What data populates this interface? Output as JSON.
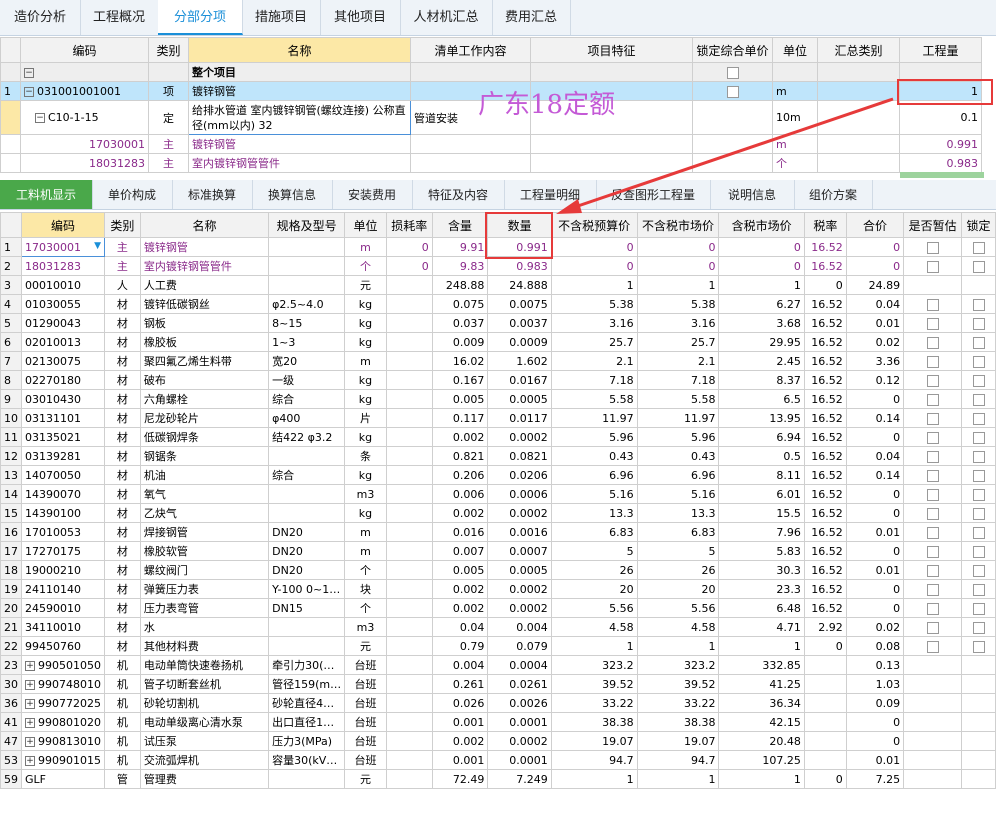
{
  "top_tabs": [
    "造价分析",
    "工程概况",
    "分部分项",
    "措施项目",
    "其他项目",
    "人材机汇总",
    "费用汇总"
  ],
  "upper_table": {
    "headers": [
      "编码",
      "类别",
      "名称",
      "清单工作内容",
      "项目特征",
      "锁定综合单价",
      "单位",
      "汇总类别",
      "工程量"
    ],
    "rows": [
      {
        "no": "",
        "code": "",
        "type": "",
        "name": "整个项目",
        "content": "",
        "feature": "",
        "unit": "",
        "sum": "",
        "qty": ""
      },
      {
        "no": "1",
        "code": "031001001001",
        "type": "项",
        "name": "镀锌钢管",
        "content": "",
        "feature": "",
        "unit": "m",
        "sum": "",
        "qty": "1"
      },
      {
        "no": "",
        "code": "C10-1-15",
        "type": "定",
        "name": "给排水管道 室内镀锌钢管(螺纹连接) 公称直径(mm以内) 32",
        "content": "管道安装",
        "feature": "",
        "unit": "10m",
        "sum": "",
        "qty": "0.1"
      },
      {
        "no": "",
        "code": "17030001",
        "type": "主",
        "name": "镀锌钢管",
        "content": "",
        "feature": "",
        "unit": "m",
        "sum": "",
        "qty": "0.991"
      },
      {
        "no": "",
        "code": "18031283",
        "type": "主",
        "name": "室内镀锌钢管管件",
        "content": "",
        "feature": "",
        "unit": "个",
        "sum": "",
        "qty": "0.983"
      }
    ]
  },
  "watermark": "广东18定额",
  "lower_tabs": [
    "工料机显示",
    "单价构成",
    "标准换算",
    "换算信息",
    "安装费用",
    "特征及内容",
    "工程量明细",
    "反查图形工程量",
    "说明信息",
    "组价方案"
  ],
  "lower_table": {
    "headers": [
      "编码",
      "类别",
      "名称",
      "规格及型号",
      "单位",
      "损耗率",
      "含量",
      "数量",
      "不含税预算价",
      "不含税市场价",
      "含税市场价",
      "税率",
      "合价",
      "是否暂估",
      "锁定"
    ],
    "rows": [
      {
        "no": "1",
        "exp": false,
        "code": "17030001",
        "type": "主",
        "name": "镀锌钢管",
        "spec": "",
        "unit": "m",
        "loss": "0",
        "content": "9.91",
        "qty": "0.991",
        "p1": "0",
        "p2": "0",
        "p3": "0",
        "tax": "16.52",
        "total": "0",
        "chk": true,
        "purple": true
      },
      {
        "no": "2",
        "exp": false,
        "code": "18031283",
        "type": "主",
        "name": "室内镀锌钢管管件",
        "spec": "",
        "unit": "个",
        "loss": "0",
        "content": "9.83",
        "qty": "0.983",
        "p1": "0",
        "p2": "0",
        "p3": "0",
        "tax": "16.52",
        "total": "0",
        "chk": true,
        "purple": true
      },
      {
        "no": "3",
        "exp": false,
        "code": "00010010",
        "type": "人",
        "name": "人工费",
        "spec": "",
        "unit": "元",
        "loss": "",
        "content": "248.88",
        "qty": "24.888",
        "p1": "1",
        "p2": "1",
        "p3": "1",
        "tax": "0",
        "total": "24.89",
        "chk": false
      },
      {
        "no": "4",
        "exp": false,
        "code": "01030055",
        "type": "材",
        "name": "镀锌低碳钢丝",
        "spec": "φ2.5~4.0",
        "unit": "kg",
        "loss": "",
        "content": "0.075",
        "qty": "0.0075",
        "p1": "5.38",
        "p2": "5.38",
        "p3": "6.27",
        "tax": "16.52",
        "total": "0.04",
        "chk": true
      },
      {
        "no": "5",
        "exp": false,
        "code": "01290043",
        "type": "材",
        "name": "钢板",
        "spec": "8~15",
        "unit": "kg",
        "loss": "",
        "content": "0.037",
        "qty": "0.0037",
        "p1": "3.16",
        "p2": "3.16",
        "p3": "3.68",
        "tax": "16.52",
        "total": "0.01",
        "chk": true
      },
      {
        "no": "6",
        "exp": false,
        "code": "02010013",
        "type": "材",
        "name": "橡胶板",
        "spec": "1~3",
        "unit": "kg",
        "loss": "",
        "content": "0.009",
        "qty": "0.0009",
        "p1": "25.7",
        "p2": "25.7",
        "p3": "29.95",
        "tax": "16.52",
        "total": "0.02",
        "chk": true
      },
      {
        "no": "7",
        "exp": false,
        "code": "02130075",
        "type": "材",
        "name": "聚四氟乙烯生料带",
        "spec": "宽20",
        "unit": "m",
        "loss": "",
        "content": "16.02",
        "qty": "1.602",
        "p1": "2.1",
        "p2": "2.1",
        "p3": "2.45",
        "tax": "16.52",
        "total": "3.36",
        "chk": true
      },
      {
        "no": "8",
        "exp": false,
        "code": "02270180",
        "type": "材",
        "name": "破布",
        "spec": "一级",
        "unit": "kg",
        "loss": "",
        "content": "0.167",
        "qty": "0.0167",
        "p1": "7.18",
        "p2": "7.18",
        "p3": "8.37",
        "tax": "16.52",
        "total": "0.12",
        "chk": true
      },
      {
        "no": "9",
        "exp": false,
        "code": "03010430",
        "type": "材",
        "name": "六角螺栓",
        "spec": "综合",
        "unit": "kg",
        "loss": "",
        "content": "0.005",
        "qty": "0.0005",
        "p1": "5.58",
        "p2": "5.58",
        "p3": "6.5",
        "tax": "16.52",
        "total": "0",
        "chk": true
      },
      {
        "no": "10",
        "exp": false,
        "code": "03131101",
        "type": "材",
        "name": "尼龙砂轮片",
        "spec": "φ400",
        "unit": "片",
        "loss": "",
        "content": "0.117",
        "qty": "0.0117",
        "p1": "11.97",
        "p2": "11.97",
        "p3": "13.95",
        "tax": "16.52",
        "total": "0.14",
        "chk": true
      },
      {
        "no": "11",
        "exp": false,
        "code": "03135021",
        "type": "材",
        "name": "低碳钢焊条",
        "spec": "结422 φ3.2",
        "unit": "kg",
        "loss": "",
        "content": "0.002",
        "qty": "0.0002",
        "p1": "5.96",
        "p2": "5.96",
        "p3": "6.94",
        "tax": "16.52",
        "total": "0",
        "chk": true
      },
      {
        "no": "12",
        "exp": false,
        "code": "03139281",
        "type": "材",
        "name": "钢锯条",
        "spec": "",
        "unit": "条",
        "loss": "",
        "content": "0.821",
        "qty": "0.0821",
        "p1": "0.43",
        "p2": "0.43",
        "p3": "0.5",
        "tax": "16.52",
        "total": "0.04",
        "chk": true
      },
      {
        "no": "13",
        "exp": false,
        "code": "14070050",
        "type": "材",
        "name": "机油",
        "spec": "综合",
        "unit": "kg",
        "loss": "",
        "content": "0.206",
        "qty": "0.0206",
        "p1": "6.96",
        "p2": "6.96",
        "p3": "8.11",
        "tax": "16.52",
        "total": "0.14",
        "chk": true
      },
      {
        "no": "14",
        "exp": false,
        "code": "14390070",
        "type": "材",
        "name": "氧气",
        "spec": "",
        "unit": "m3",
        "loss": "",
        "content": "0.006",
        "qty": "0.0006",
        "p1": "5.16",
        "p2": "5.16",
        "p3": "6.01",
        "tax": "16.52",
        "total": "0",
        "chk": true
      },
      {
        "no": "15",
        "exp": false,
        "code": "14390100",
        "type": "材",
        "name": "乙炔气",
        "spec": "",
        "unit": "kg",
        "loss": "",
        "content": "0.002",
        "qty": "0.0002",
        "p1": "13.3",
        "p2": "13.3",
        "p3": "15.5",
        "tax": "16.52",
        "total": "0",
        "chk": true
      },
      {
        "no": "16",
        "exp": false,
        "code": "17010053",
        "type": "材",
        "name": "焊接钢管",
        "spec": "DN20",
        "unit": "m",
        "loss": "",
        "content": "0.016",
        "qty": "0.0016",
        "p1": "6.83",
        "p2": "6.83",
        "p3": "7.96",
        "tax": "16.52",
        "total": "0.01",
        "chk": true
      },
      {
        "no": "17",
        "exp": false,
        "code": "17270175",
        "type": "材",
        "name": "橡胶软管",
        "spec": "DN20",
        "unit": "m",
        "loss": "",
        "content": "0.007",
        "qty": "0.0007",
        "p1": "5",
        "p2": "5",
        "p3": "5.83",
        "tax": "16.52",
        "total": "0",
        "chk": true
      },
      {
        "no": "18",
        "exp": false,
        "code": "19000210",
        "type": "材",
        "name": "螺纹阀门",
        "spec": "DN20",
        "unit": "个",
        "loss": "",
        "content": "0.005",
        "qty": "0.0005",
        "p1": "26",
        "p2": "26",
        "p3": "30.3",
        "tax": "16.52",
        "total": "0.01",
        "chk": true
      },
      {
        "no": "19",
        "exp": false,
        "code": "24110140",
        "type": "材",
        "name": "弹簧压力表",
        "spec": "Y-100 0~1…",
        "unit": "块",
        "loss": "",
        "content": "0.002",
        "qty": "0.0002",
        "p1": "20",
        "p2": "20",
        "p3": "23.3",
        "tax": "16.52",
        "total": "0",
        "chk": true
      },
      {
        "no": "20",
        "exp": false,
        "code": "24590010",
        "type": "材",
        "name": "压力表弯管",
        "spec": "DN15",
        "unit": "个",
        "loss": "",
        "content": "0.002",
        "qty": "0.0002",
        "p1": "5.56",
        "p2": "5.56",
        "p3": "6.48",
        "tax": "16.52",
        "total": "0",
        "chk": true
      },
      {
        "no": "21",
        "exp": false,
        "code": "34110010",
        "type": "材",
        "name": "水",
        "spec": "",
        "unit": "m3",
        "loss": "",
        "content": "0.04",
        "qty": "0.004",
        "p1": "4.58",
        "p2": "4.58",
        "p3": "4.71",
        "tax": "2.92",
        "total": "0.02",
        "chk": true
      },
      {
        "no": "22",
        "exp": false,
        "code": "99450760",
        "type": "材",
        "name": "其他材料费",
        "spec": "",
        "unit": "元",
        "loss": "",
        "content": "0.79",
        "qty": "0.079",
        "p1": "1",
        "p2": "1",
        "p3": "1",
        "tax": "0",
        "total": "0.08",
        "chk": true
      },
      {
        "no": "23",
        "exp": true,
        "code": "990501050",
        "type": "机",
        "name": "电动单筒快速卷扬机",
        "spec": "牵引力30(…",
        "unit": "台班",
        "loss": "",
        "content": "0.004",
        "qty": "0.0004",
        "p1": "323.2",
        "p2": "323.2",
        "p3": "332.85",
        "tax": "",
        "total": "0.13",
        "chk": false
      },
      {
        "no": "30",
        "exp": true,
        "code": "990748010",
        "type": "机",
        "name": "管子切断套丝机",
        "spec": "管径159(m…",
        "unit": "台班",
        "loss": "",
        "content": "0.261",
        "qty": "0.0261",
        "p1": "39.52",
        "p2": "39.52",
        "p3": "41.25",
        "tax": "",
        "total": "1.03",
        "chk": false
      },
      {
        "no": "36",
        "exp": true,
        "code": "990772025",
        "type": "机",
        "name": "砂轮切割机",
        "spec": "砂轮直径4…",
        "unit": "台班",
        "loss": "",
        "content": "0.026",
        "qty": "0.0026",
        "p1": "33.22",
        "p2": "33.22",
        "p3": "36.34",
        "tax": "",
        "total": "0.09",
        "chk": false
      },
      {
        "no": "41",
        "exp": true,
        "code": "990801020",
        "type": "机",
        "name": "电动单级离心清水泵",
        "spec": "出口直径1…",
        "unit": "台班",
        "loss": "",
        "content": "0.001",
        "qty": "0.0001",
        "p1": "38.38",
        "p2": "38.38",
        "p3": "42.15",
        "tax": "",
        "total": "0",
        "chk": false
      },
      {
        "no": "47",
        "exp": true,
        "code": "990813010",
        "type": "机",
        "name": "试压泵",
        "spec": "压力3(MPa)",
        "unit": "台班",
        "loss": "",
        "content": "0.002",
        "qty": "0.0002",
        "p1": "19.07",
        "p2": "19.07",
        "p3": "20.48",
        "tax": "",
        "total": "0",
        "chk": false
      },
      {
        "no": "53",
        "exp": true,
        "code": "990901015",
        "type": "机",
        "name": "交流弧焊机",
        "spec": "容量30(kV…",
        "unit": "台班",
        "loss": "",
        "content": "0.001",
        "qty": "0.0001",
        "p1": "94.7",
        "p2": "94.7",
        "p3": "107.25",
        "tax": "",
        "total": "0.01",
        "chk": false
      },
      {
        "no": "59",
        "exp": false,
        "code": "GLF",
        "type": "管",
        "name": "管理费",
        "spec": "",
        "unit": "元",
        "loss": "",
        "content": "72.49",
        "qty": "7.249",
        "p1": "1",
        "p2": "1",
        "p3": "1",
        "tax": "0",
        "total": "7.25",
        "chk": false
      }
    ]
  },
  "colors": {
    "accent": "#1a8fd8",
    "highlight": "#bfe5fb",
    "annotation": "#e63a3a",
    "material_text": "#8a2a8a",
    "active_tab": "#4aa84a"
  }
}
